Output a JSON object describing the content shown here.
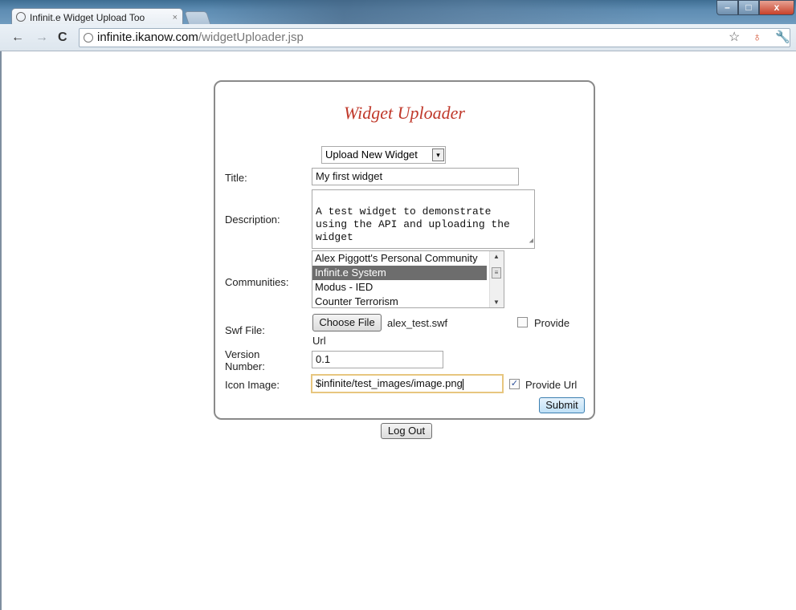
{
  "browser": {
    "tab_title": "Infinit.e Widget Upload Too",
    "tab_close": "×",
    "url_host": "infinite.ikanow.com",
    "url_path": "/widgetUploader.jsp",
    "nav_back": "←",
    "nav_forward": "→",
    "nav_reload": "C",
    "bookmark_icon": "☆",
    "extension_icon": "♁",
    "wrench_icon": "🔧",
    "win_min": "–",
    "win_max": "□",
    "win_close": "x"
  },
  "form": {
    "heading": "Widget Uploader",
    "mode_select": {
      "value": "Upload New Widget",
      "arrow": "▾"
    },
    "title_label": "Title:",
    "title_value": "My first widget",
    "description_label": "Description:",
    "description_value": "A test widget to demonstrate\nusing the API and uploading the\nwidget",
    "communities_label": "Communities:",
    "communities": [
      {
        "name": "Alex Piggott's Personal Community",
        "selected": false
      },
      {
        "name": "Infinit.e System",
        "selected": true
      },
      {
        "name": "Modus - IED",
        "selected": false
      },
      {
        "name": "Counter Terrorism",
        "selected": false
      }
    ],
    "swf_label": "Swf File:",
    "choose_file_label": "Choose File",
    "swf_filename": "alex_test.swf",
    "swf_provide_label_1": "Provide",
    "swf_provide_label_2": "Url",
    "swf_provide_checked": false,
    "version_label_1": "Version",
    "version_label_2": "Number:",
    "version_value": "0.1",
    "icon_label": "Icon Image:",
    "icon_value": "$infinite/test_images/image.png",
    "icon_provide_label": "Provide Url",
    "icon_provide_checked": true,
    "submit_label": "Submit"
  },
  "logout_label": "Log Out"
}
